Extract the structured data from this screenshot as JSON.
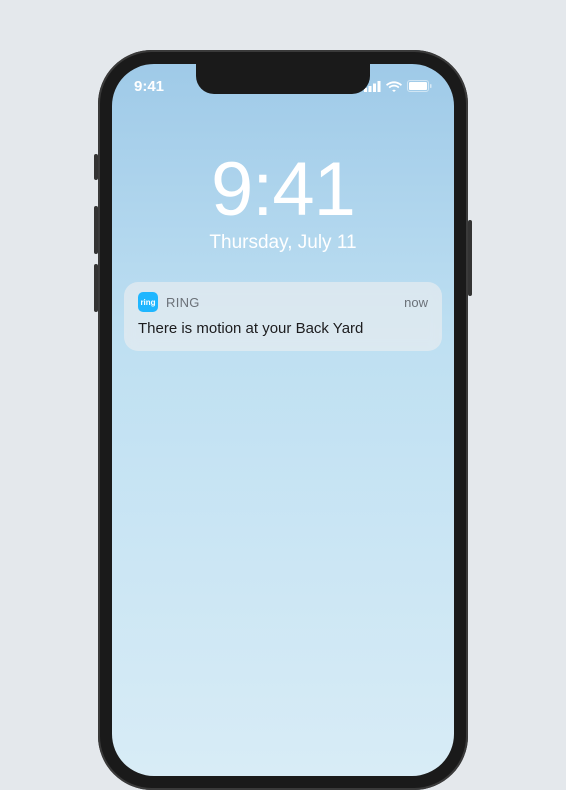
{
  "statusbar": {
    "time": "9:41"
  },
  "lockscreen": {
    "time": "9:41",
    "date": "Thursday, July 11"
  },
  "notification": {
    "icon_text": "ring",
    "app_name": "RING",
    "timestamp": "now",
    "message": "There is motion at your Back Yard"
  }
}
